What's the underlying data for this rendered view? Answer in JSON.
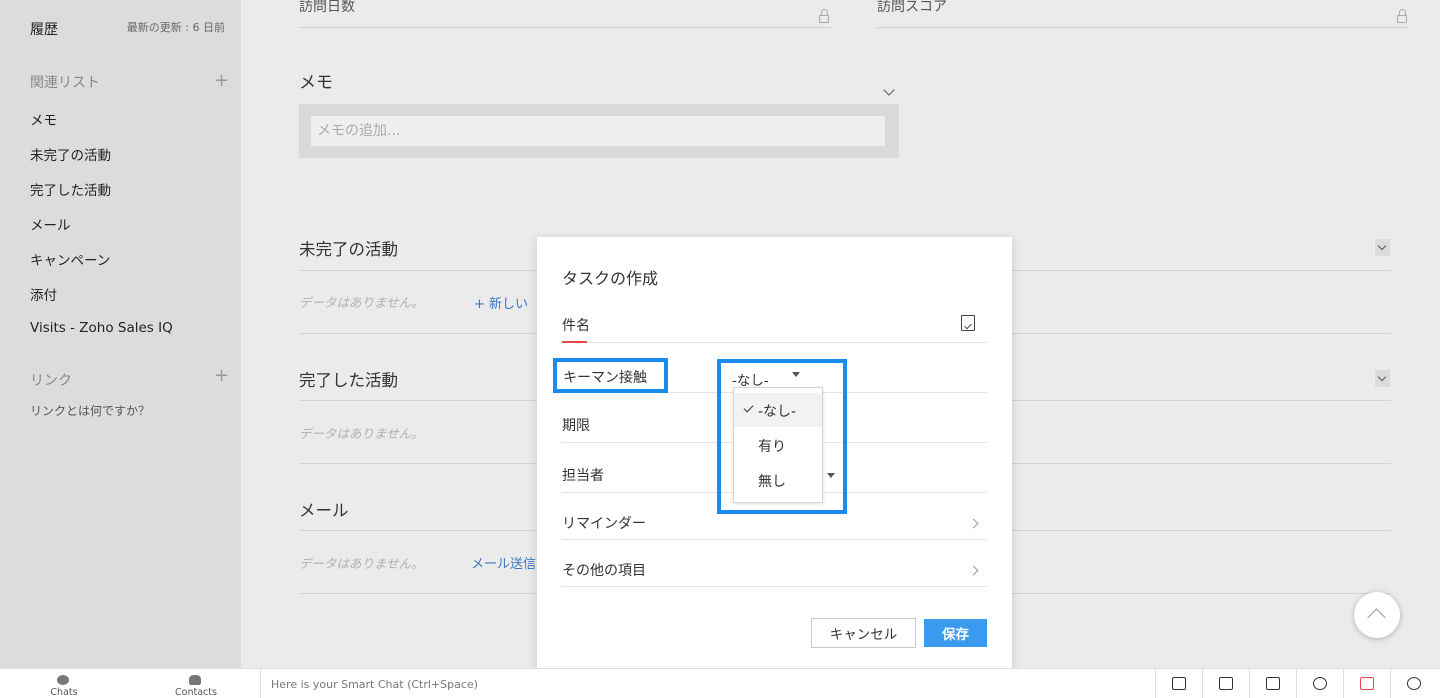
{
  "sidebar": {
    "history_label": "履歴",
    "last_updated": "最新の更新 : 6 日前",
    "related_list_title": "関連リスト",
    "related_items": [
      "メモ",
      "未完了の活動",
      "完了した活動",
      "メール",
      "キャンペーン",
      "添付",
      "Visits - Zoho Sales IQ"
    ],
    "links_title": "リンク",
    "links_help": "リンクとは何ですか？",
    "plus": "+"
  },
  "main": {
    "field_left_label": "訪問日数",
    "field_right_label": "訪問スコア",
    "memo_title": "メモ",
    "memo_placeholder": "メモの追加...",
    "sections": [
      {
        "title": "未完了の活動",
        "empty": "データはありません。",
        "link": "+ 新しい"
      },
      {
        "title": "完了した活動",
        "empty": "データはありません。",
        "link": ""
      },
      {
        "title": "メール",
        "empty": "データはありません。",
        "link": "メール送信"
      }
    ]
  },
  "modal": {
    "title": "タスクの作成",
    "subject_label": "件名",
    "keyman_label": "キーマン接触",
    "keyman_value": "-なし-",
    "due_label": "期限",
    "owner_label": "担当者",
    "reminder_label": "リマインダー",
    "other_label": "その他の項目",
    "dropdown_options": [
      "-なし-",
      "有り",
      "無し"
    ],
    "selected_option": "-なし-",
    "cancel_label": "キャンセル",
    "save_label": "保存"
  },
  "bottombar": {
    "chats_label": "Chats",
    "contacts_label": "Contacts",
    "smartchat_placeholder": "Here is your Smart Chat (Ctrl+Space)",
    "icons": [
      "screen-share-icon",
      "clipboard-icon",
      "zia-icon",
      "alarm-icon",
      "phone-icon",
      "history-icon"
    ]
  },
  "colors": {
    "highlight": "#1a8cf0",
    "save_button": "#3a9bee",
    "required": "#e5484d",
    "link": "#3b76c4"
  }
}
